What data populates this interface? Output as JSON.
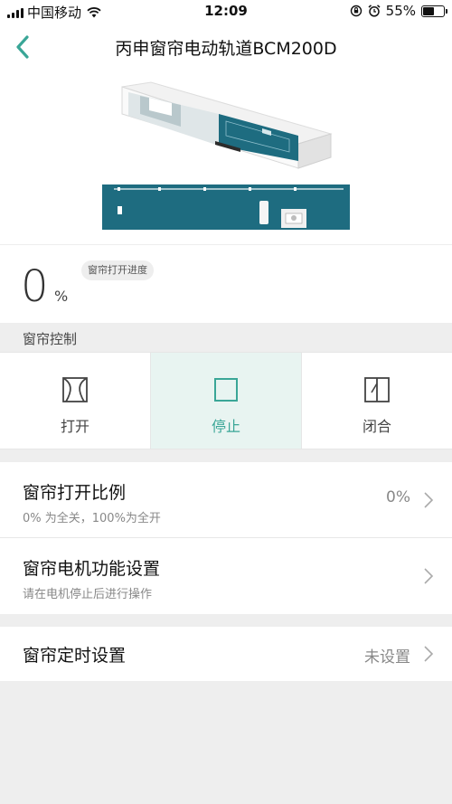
{
  "status_bar": {
    "carrier": "中国移动",
    "time": "12:09",
    "battery": "55%",
    "battery_level": 0.55
  },
  "nav": {
    "title": "丙申窗帘电动轨道BCM200D",
    "back_icon": "chevron-left-icon"
  },
  "progress": {
    "value": "0",
    "unit": "%",
    "label": "窗帘打开进度"
  },
  "control": {
    "section_label": "窗帘控制",
    "buttons": [
      {
        "label": "打开",
        "icon": "curtain-open-icon",
        "active": false
      },
      {
        "label": "停止",
        "icon": "stop-square-icon",
        "active": true
      },
      {
        "label": "闭合",
        "icon": "curtain-close-icon",
        "active": false
      }
    ]
  },
  "settings": {
    "rows": [
      {
        "title": "窗帘打开比例",
        "subtitle": "0% 为全关，100%为全开",
        "value": "0%"
      },
      {
        "title": "窗帘电机功能设置",
        "subtitle": "请在电机停止后进行操作",
        "value": ""
      }
    ],
    "timer": {
      "title": "窗帘定时设置",
      "value": "未设置"
    }
  },
  "colors": {
    "accent": "#3aa697",
    "accent_bg": "#e8f4f1",
    "page_bg": "#eeeeee",
    "product_teal": "#1e6c80"
  }
}
